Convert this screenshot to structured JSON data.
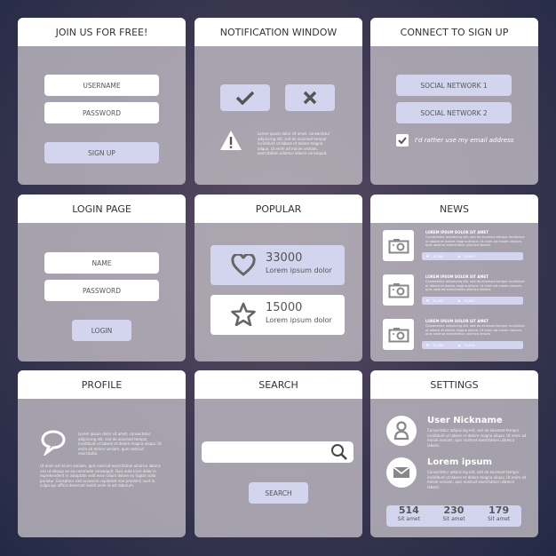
{
  "join": {
    "title": "JOIN US FOR FREE!",
    "username": "USERNAME",
    "password": "PASSWORD",
    "signup": "SIGN UP"
  },
  "notification": {
    "title": "NOTIFICATION WINDOW",
    "text": "Lorem ipsum dolor sit amet, consectetur adipiscing elit, sed do eiusmod tempor incididunt ut labore et dolore magna aliqua. Ut enim ad minim veniam, exercitation ullamco laboris consequat."
  },
  "connect": {
    "title": "CONNECT TO SIGN UP",
    "network1": "SOCIAL NETWORK 1",
    "network2": "SOCIAL NETWORK 2",
    "email_option": "I'd rather use my email address"
  },
  "login": {
    "title": "LOGIN PAGE",
    "name": "NAME",
    "password": "PASSWORD",
    "login": "LOGIN"
  },
  "popular": {
    "title": "POPULAR",
    "items": [
      {
        "count": "33000",
        "label": "Lorem ipsum dolor",
        "icon": "heart-icon"
      },
      {
        "count": "15000",
        "label": "Lorem ipsum dolor",
        "icon": "star-icon"
      }
    ]
  },
  "news": {
    "title": "NEWS",
    "items": [
      {
        "heading": "LOREM IPSUM DOLOR SIT AMET",
        "text": "Consectetur adipiscing elit, sed do eiusmod tempor incididunt ut labore et dolore magna aliqua. Ut enim ad minim veniam, quis nostrud exercitation ullamco laboris.",
        "likes": "10,000",
        "views": "10,000"
      },
      {
        "heading": "LOREM IPSUM DOLOR SIT AMET",
        "text": "Consectetur adipiscing elit, sed do eiusmod tempor incididunt ut labore et dolore magna aliqua. Ut enim ad minim veniam, quis nostrud exercitation ullamco laboris.",
        "likes": "10,000",
        "views": "10,000"
      },
      {
        "heading": "LOREM IPSUM DOLOR SIT AMET",
        "text": "Consectetur adipiscing elit, sed do eiusmod tempor incididunt ut labore et dolore magna aliqua. Ut enim ad minim veniam, quis nostrud exercitation ullamco laboris.",
        "likes": "10,000",
        "views": "10,000"
      }
    ]
  },
  "profile": {
    "title": "PROFILE",
    "text1": "Lorem ipsum dolor sit amet, consectetur adipiscing elit, sed do eiusmod tempor incididunt ut labore et dolore magna aliqua. Ut enim ad minim veniam, quis nostrud exercitatio.",
    "text2": "Ut enim ad minim veniam, quis nostrud exercitation ullamco laboris nisi ut aliquip ex ea commodo consequat. Duis aute irure dolor in reprehenderit in voluptate velit esse cillum dolore eu fugiat nulla pariatur. Excepteur sint occaecat cupidatat non proident, sunt in culpa qui officia deserunt mollit anim id est laborum."
  },
  "search": {
    "title": "SEARCH",
    "placeholder": "",
    "button": "SEARCH"
  },
  "settings": {
    "title": "SETTINGS",
    "nickname": "User Nickname",
    "nickname_text": "Consectetur adipiscing elit, sed do eiusmod tempor incididunt ut labore et dolore magna aliqua. Ut enim ad minim veniam, quis nostrud exercitation ullamco laboris.",
    "email_title": "Lorem ipsum",
    "email_text": "Consectetur adipiscing elit, sed do eiusmod tempor incididunt ut labore et dolore magna aliqua. Ut enim ad minim veniam, quis nostrud exercitation ullamco laboris.",
    "stats": [
      {
        "value": "514",
        "label": "Sit amet"
      },
      {
        "value": "230",
        "label": "Sit amet"
      },
      {
        "value": "179",
        "label": "Sit amet"
      }
    ]
  },
  "colors": {
    "accent": "#d3d5ee",
    "panel": "#bebac2",
    "icon": "#666666"
  }
}
